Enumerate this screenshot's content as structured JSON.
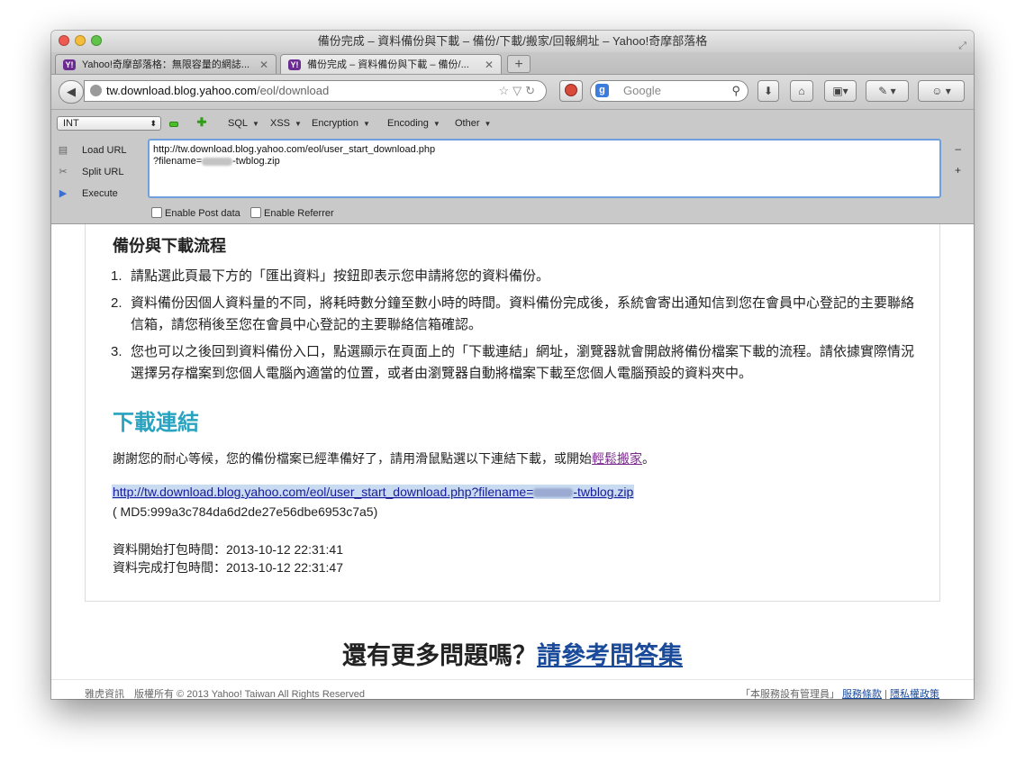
{
  "window": {
    "title": "備份完成 – 資料備份與下載 – 備份/下載/搬家/回報網址 – Yahoo!奇摩部落格"
  },
  "tabs": [
    {
      "label": "Yahoo!奇摩部落格：無限容量的網誌...",
      "favicon": "Y!"
    },
    {
      "label": "備份完成 – 資料備份與下載 – 備份/...",
      "favicon": "Y!"
    }
  ],
  "newtab_label": "+",
  "navbar": {
    "url_host": "tw.download.blog.yahoo.com",
    "url_path": "/eol/download",
    "search_placeholder": "Google",
    "search_engine_letter": "g"
  },
  "hackbar": {
    "select_value": "INT",
    "menus": [
      "SQL",
      "XSS",
      "Encryption",
      "Encoding",
      "Other"
    ],
    "load_url": "Load URL",
    "split_url": "Split URL",
    "execute": "Execute",
    "textarea_line1": "http://tw.download.blog.yahoo.com/eol/user_start_download.php",
    "textarea_line2_prefix": "?filename=",
    "textarea_line2_suffix": "-twblog.zip",
    "minus_edge": "–",
    "plus_edge": "+",
    "enable_post": "Enable Post data",
    "enable_referrer": "Enable Referrer"
  },
  "content": {
    "flow_heading": "備份與下載流程",
    "steps": [
      {
        "num": "1.",
        "text": "請點選此頁最下方的「匯出資料」按鈕即表示您申請將您的資料備份。"
      },
      {
        "num": "2.",
        "text": "資料備份因個人資料量的不同，將耗時數分鐘至數小時的時間。資料備份完成後，系統會寄出通知信到您在會員中心登記的主要聯絡信箱，請您稍後至您在會員中心登記的主要聯絡信箱確認。"
      },
      {
        "num": "3.",
        "text": "您也可以之後回到資料備份入口，點選顯示在頁面上的「下載連結」網址，瀏覽器就會開啟將備份檔案下載的流程。請依據實際情況選擇另存檔案到您個人電腦內適當的位置，或者由瀏覽器自動將檔案下載至您個人電腦預設的資料夾中。"
      }
    ],
    "download_heading": "下載連結",
    "intro_text": "謝謝您的耐心等候，您的備份檔案已經準備好了，請用滑鼠點選以下連結下載，或開始",
    "intro_link": "輕鬆搬家",
    "intro_end": "。",
    "link_prefix": "http://tw.download.blog.yahoo.com/eol/user_start_download.php?filename=",
    "link_suffix": "-twblog.zip",
    "md5": "( MD5:999a3c784da6d2de27e56dbe6953c7a5)",
    "start_time": "資料開始打包時間：2013-10-12 22:31:41",
    "end_time": "資料完成打包時間：2013-10-12 22:31:47",
    "more_question": "還有更多問題嗎？",
    "faq_link": "請參考問答集"
  },
  "footer": {
    "left": "雅虎資訊　版權所有 © 2013 Yahoo! Taiwan All Rights Reserved",
    "admin": "「本服務設有管理員」",
    "terms": "服務條款",
    "sep": "|",
    "privacy": "隱私權政策"
  }
}
